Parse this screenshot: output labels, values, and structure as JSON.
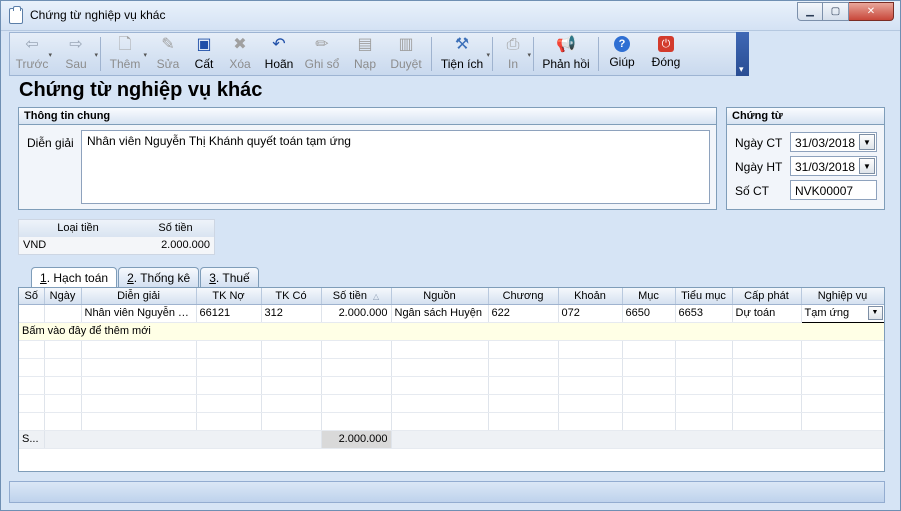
{
  "window": {
    "title": "Chứng từ nghiệp vụ khác"
  },
  "toolbar": {
    "buttons": [
      {
        "label": "Trước",
        "icon": "arrow-left-icon",
        "enabled": false
      },
      {
        "label": "Sau",
        "icon": "arrow-right-icon",
        "enabled": false
      },
      {
        "label": "Thêm",
        "icon": "add-document-icon",
        "enabled": false
      },
      {
        "label": "Sửa",
        "icon": "edit-document-icon",
        "enabled": false
      },
      {
        "label": "Cất",
        "icon": "save-icon",
        "enabled": true
      },
      {
        "label": "Xóa",
        "icon": "delete-icon",
        "enabled": false
      },
      {
        "label": "Hoãn",
        "icon": "undo-icon",
        "enabled": true
      },
      {
        "label": "Ghi sổ",
        "icon": "pencil-icon",
        "enabled": false
      },
      {
        "label": "Nạp",
        "icon": "load-icon",
        "enabled": false
      },
      {
        "label": "Duyệt",
        "icon": "approve-icon",
        "enabled": false
      },
      {
        "label": "Tiện ích",
        "icon": "tools-icon",
        "enabled": true
      },
      {
        "label": "In",
        "icon": "printer-icon",
        "enabled": false
      },
      {
        "label": "Phản hồi",
        "icon": "megaphone-icon",
        "enabled": true
      },
      {
        "label": "Giúp",
        "icon": "help-icon",
        "enabled": true
      },
      {
        "label": "Đóng",
        "icon": "power-icon",
        "enabled": true
      }
    ]
  },
  "page_title": "Chứng từ nghiệp vụ khác",
  "general_info": {
    "header": "Thông tin chung",
    "description_label": "Diễn giải",
    "description_value": "Nhân viên Nguyễn Thị Khánh quyết toán tạm ứng"
  },
  "voucher": {
    "header": "Chứng từ",
    "date_ct_label": "Ngày CT",
    "date_ct_value": "31/03/2018",
    "date_ht_label": "Ngày HT",
    "date_ht_value": "31/03/2018",
    "number_label": "Số CT",
    "number_value": "NVK00007"
  },
  "currency": {
    "headers": [
      "Loại tiền",
      "Số tiền"
    ],
    "currency_value": "VND",
    "amount_value": "2.000.000"
  },
  "tabs": [
    {
      "num": "1",
      "label": ". Hạch toán"
    },
    {
      "num": "2",
      "label": ". Thống kê"
    },
    {
      "num": "3",
      "label": ". Thuế"
    }
  ],
  "grid": {
    "columns": [
      "Số",
      "Ngày",
      "Diễn giải",
      "TK Nợ",
      "TK Có",
      "Số tiền",
      "Nguồn",
      "Chương",
      "Khoản",
      "Mục",
      "Tiểu mục",
      "Cấp phát",
      "Nghiệp vụ"
    ],
    "row": {
      "so": "",
      "ngay": "",
      "dien_giai": "Nhân viên Nguyễn Thị Khánh",
      "tk_no": "66121",
      "tk_co": "312",
      "so_tien": "2.000.000",
      "nguon": "Ngân sách Huyện",
      "chuong": "622",
      "khoan": "072",
      "muc": "6650",
      "tieu_muc": "6653",
      "cap_phat": "Dự toán",
      "nghiep_vu": "Tạm ứng"
    },
    "add_row_text": "Bấm vào đây để thêm mới",
    "footer_label": "S...",
    "footer_total": "2.000.000"
  }
}
